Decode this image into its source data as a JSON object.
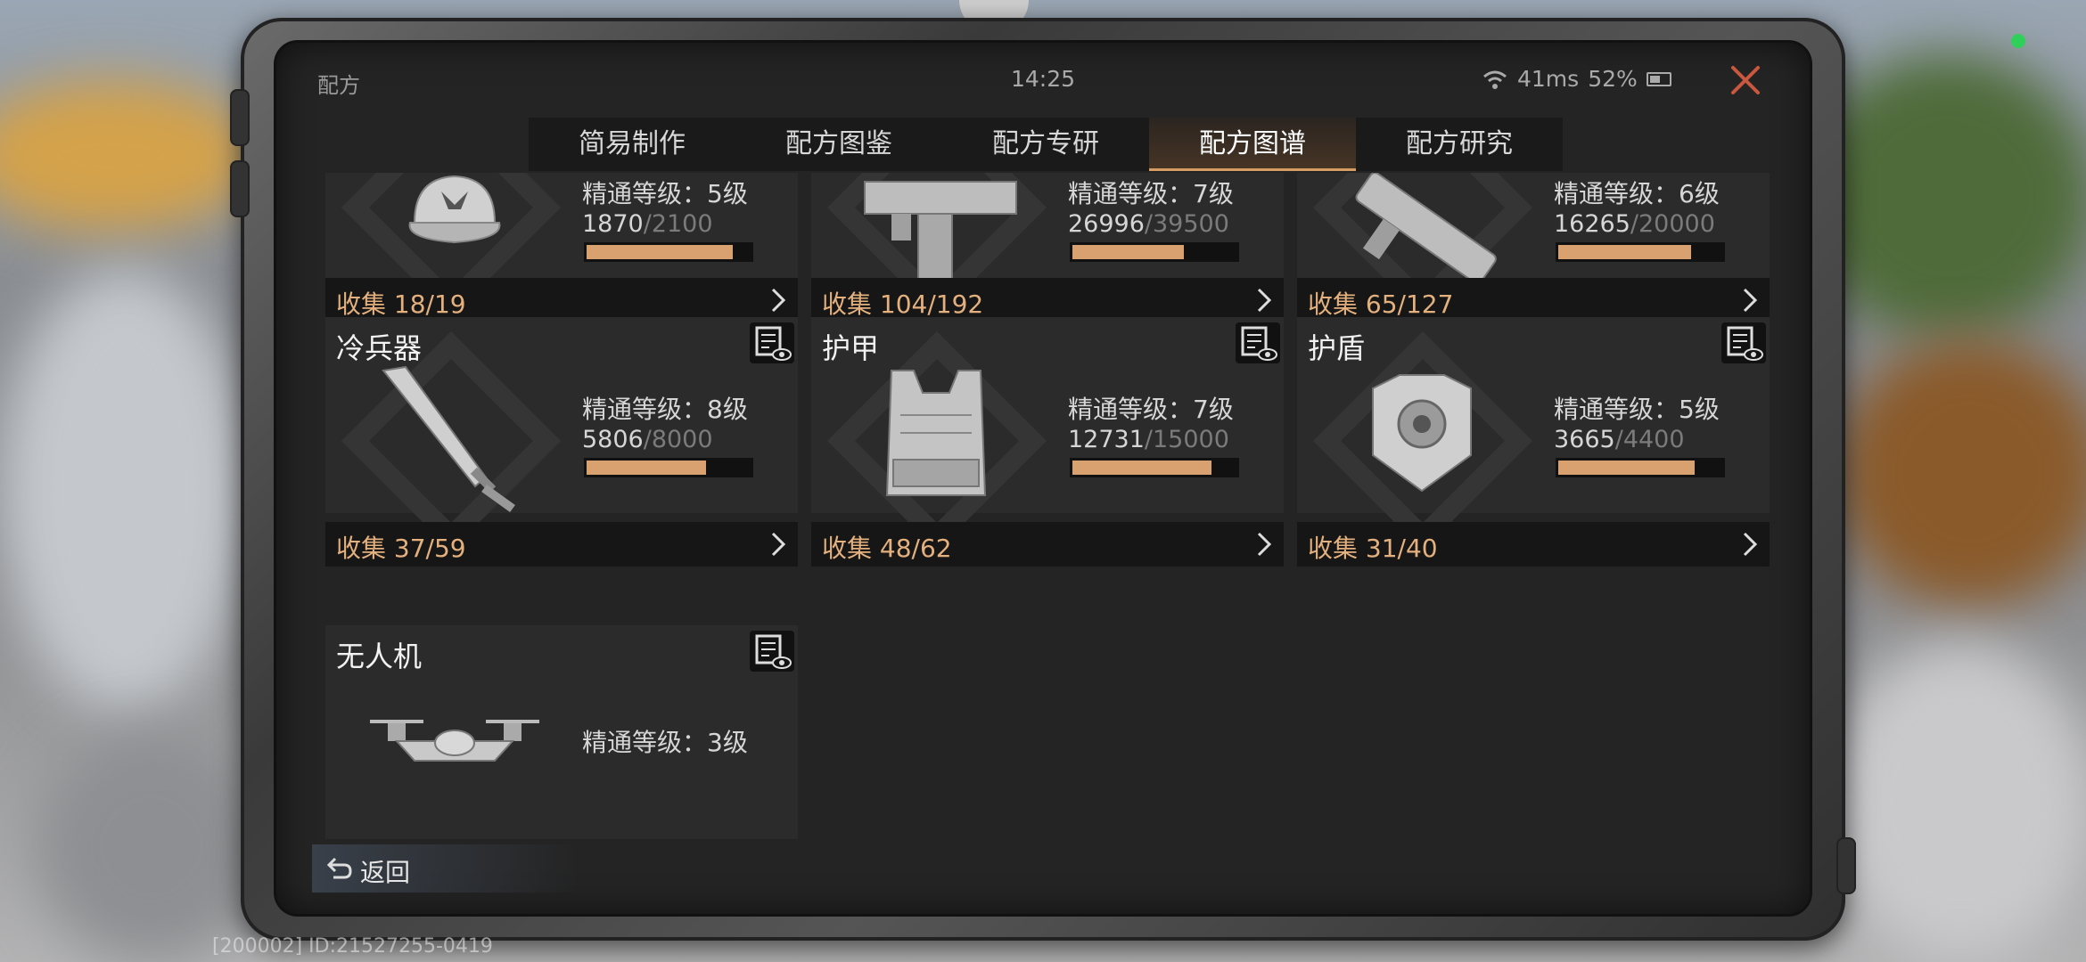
{
  "app": {
    "title": "配方"
  },
  "status": {
    "time": "14:25",
    "ping": "41ms",
    "battery": "52%"
  },
  "tabs": [
    {
      "label": "简易制作",
      "active": false
    },
    {
      "label": "配方图鉴",
      "active": false
    },
    {
      "label": "配方专研",
      "active": false
    },
    {
      "label": "配方图谱",
      "active": true
    },
    {
      "label": "配方研究",
      "active": false
    }
  ],
  "cards": [
    {
      "name": "",
      "icon": "cap-icon",
      "level": "精通等级：5级",
      "current": "1870",
      "max": "/2100",
      "fill": 0.89,
      "collect": "收集 18/19"
    },
    {
      "name": "",
      "icon": "smg-icon",
      "level": "精通等级：7级",
      "current": "26996",
      "max": "/39500",
      "fill": 0.68,
      "collect": "收集 104/192"
    },
    {
      "name": "",
      "icon": "launcher-icon",
      "level": "精通等级：6级",
      "current": "16265",
      "max": "/20000",
      "fill": 0.81,
      "collect": "收集 65/127"
    },
    {
      "name": "冷兵器",
      "icon": "blade-icon",
      "level": "精通等级：8级",
      "current": "5806",
      "max": "/8000",
      "fill": 0.73,
      "collect": "收集 37/59"
    },
    {
      "name": "护甲",
      "icon": "vest-icon",
      "level": "精通等级：7级",
      "current": "12731",
      "max": "/15000",
      "fill": 0.85,
      "collect": "收集 48/62"
    },
    {
      "name": "护盾",
      "icon": "shield-armor-icon",
      "level": "精通等级：5级",
      "current": "3665",
      "max": "/4400",
      "fill": 0.83,
      "collect": "收集 31/40"
    },
    {
      "name": "无人机",
      "icon": "drone-icon",
      "level": "精通等级：3级"
    }
  ],
  "back": {
    "label": "返回"
  },
  "footer": {
    "id": "[200002] ID:21527255-0419"
  },
  "colors": {
    "accent": "#d9a070",
    "collect_text": "#e3b07e",
    "tab_active_border": "#d79c63"
  }
}
